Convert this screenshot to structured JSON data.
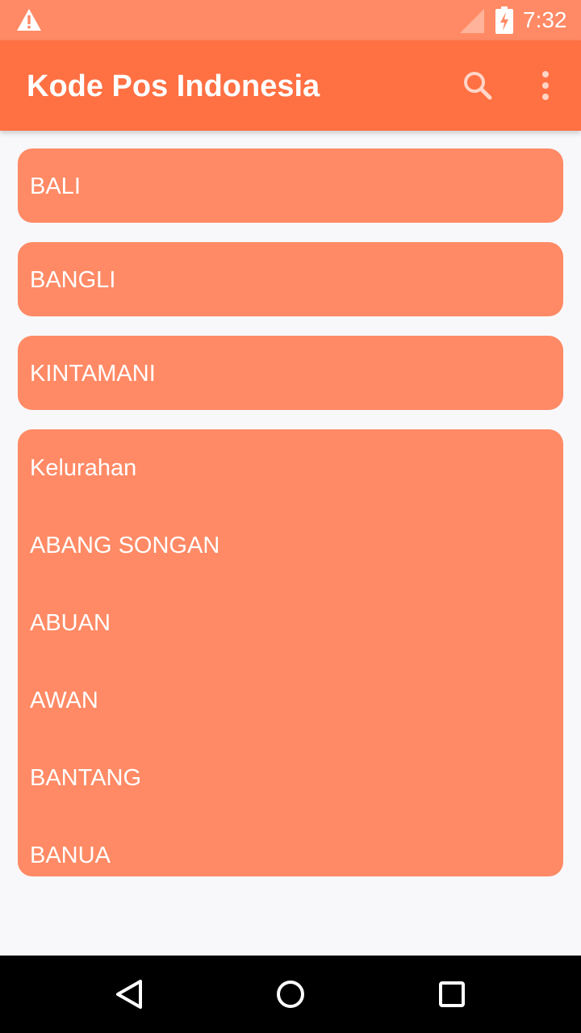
{
  "status_bar": {
    "time": "7:32",
    "icons": [
      "warning-icon",
      "signal-icon",
      "battery-charging-icon"
    ]
  },
  "app_bar": {
    "title": "Kode Pos Indonesia",
    "actions": [
      "search-icon",
      "more-vert-icon"
    ]
  },
  "breadcrumb": {
    "province": "BALI",
    "regency": "BANGLI",
    "district": "KINTAMANI"
  },
  "villages": {
    "header": "Kelurahan",
    "items": [
      "ABANG SONGAN",
      "ABUAN",
      "AWAN",
      "BANTANG",
      "BANUA"
    ]
  },
  "nav_bar": {
    "buttons": [
      "back-icon",
      "home-icon",
      "recents-icon"
    ]
  },
  "colors": {
    "status_bar": "#ff8a65",
    "app_bar": "#ff7043",
    "card": "#ff8a65",
    "background": "#f8f8fa"
  }
}
